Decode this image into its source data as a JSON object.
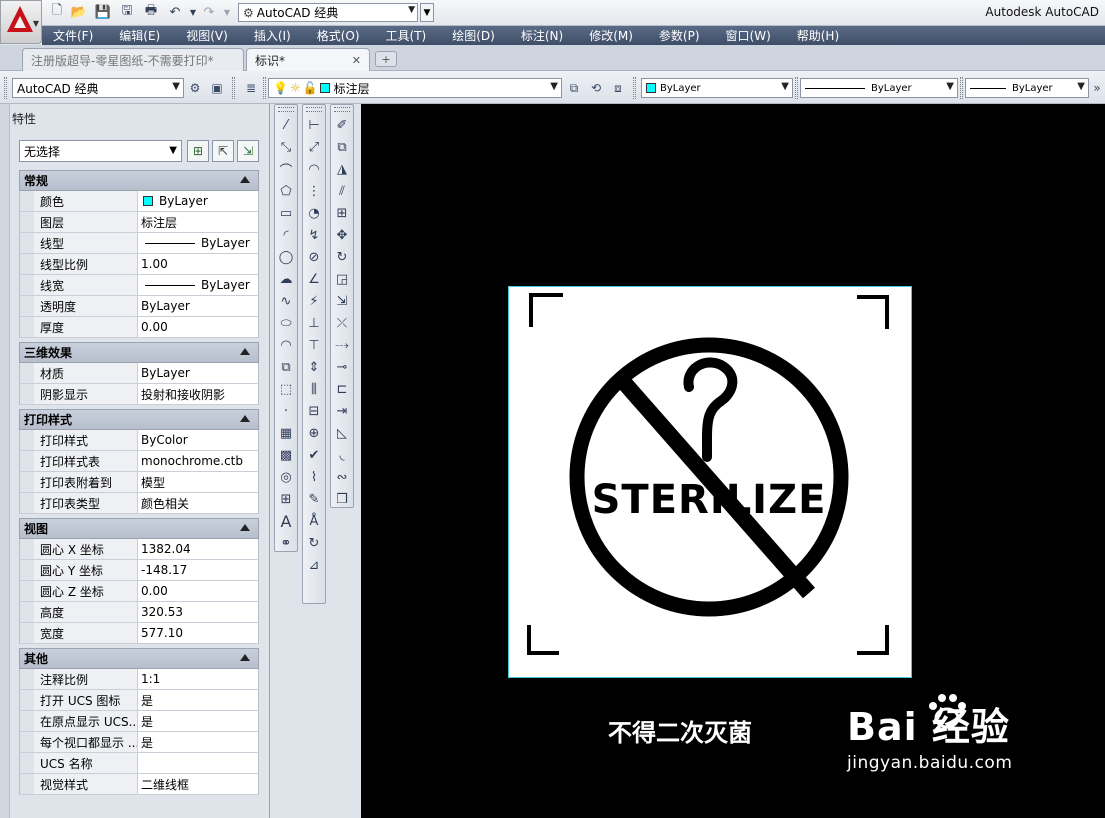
{
  "app": {
    "title": "Autodesk AutoCAD",
    "workspace": "AutoCAD 经典"
  },
  "menu": [
    "文件(F)",
    "编辑(E)",
    "视图(V)",
    "插入(I)",
    "格式(O)",
    "工具(T)",
    "绘图(D)",
    "标注(N)",
    "修改(M)",
    "参数(P)",
    "窗口(W)",
    "帮助(H)"
  ],
  "tabs": [
    {
      "label": "注册版超导-零星图纸-不需要打印*",
      "active": false
    },
    {
      "label": "标识*",
      "active": true
    }
  ],
  "toolbar": {
    "workspace": "AutoCAD 经典",
    "layer": "标注层",
    "color": "ByLayer",
    "linetype": "ByLayer",
    "lineweight": "ByLayer",
    "colors": {
      "layer_swatch": "#00ffff"
    }
  },
  "properties": {
    "title": "特性",
    "selection": "无选择",
    "sections": [
      {
        "title": "常规",
        "rows": [
          {
            "key": "颜色",
            "value": "ByLayer",
            "swatch": "#00ffff"
          },
          {
            "key": "图层",
            "value": "标注层"
          },
          {
            "key": "线型",
            "value": "ByLayer",
            "line": true
          },
          {
            "key": "线型比例",
            "value": "1.00"
          },
          {
            "key": "线宽",
            "value": "ByLayer",
            "line": true
          },
          {
            "key": "透明度",
            "value": "ByLayer"
          },
          {
            "key": "厚度",
            "value": "0.00"
          }
        ]
      },
      {
        "title": "三维效果",
        "rows": [
          {
            "key": "材质",
            "value": "ByLayer"
          },
          {
            "key": "阴影显示",
            "value": "投射和接收阴影"
          }
        ]
      },
      {
        "title": "打印样式",
        "rows": [
          {
            "key": "打印样式",
            "value": "ByColor"
          },
          {
            "key": "打印样式表",
            "value": "monochrome.ctb"
          },
          {
            "key": "打印表附着到",
            "value": "模型"
          },
          {
            "key": "打印表类型",
            "value": "颜色相关"
          }
        ]
      },
      {
        "title": "视图",
        "rows": [
          {
            "key": "圆心 X 坐标",
            "value": "1382.04"
          },
          {
            "key": "圆心 Y 坐标",
            "value": "-148.17"
          },
          {
            "key": "圆心 Z 坐标",
            "value": "0.00"
          },
          {
            "key": "高度",
            "value": "320.53"
          },
          {
            "key": "宽度",
            "value": "577.10"
          }
        ]
      },
      {
        "title": "其他",
        "rows": [
          {
            "key": "注释比例",
            "value": "1:1"
          },
          {
            "key": "打开 UCS 图标",
            "value": "是"
          },
          {
            "key": "在原点显示 UCS...",
            "value": "是"
          },
          {
            "key": "每个视口都显示 ...",
            "value": "是"
          },
          {
            "key": "UCS 名称",
            "value": ""
          },
          {
            "key": "视觉样式",
            "value": "二维线框"
          }
        ]
      }
    ]
  },
  "drawing": {
    "sign_text": "STERILIZE",
    "caption": "不得二次灭菌"
  },
  "watermark": {
    "brand": "Bai  经验",
    "url": "jingyan.baidu.com"
  }
}
